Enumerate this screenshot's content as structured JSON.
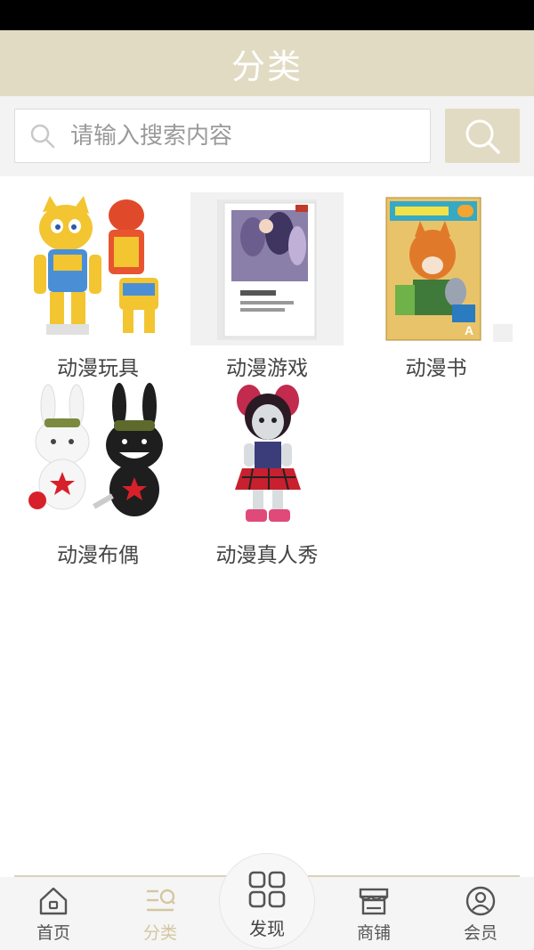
{
  "header": {
    "title": "分类"
  },
  "search": {
    "placeholder": "请输入搜索内容",
    "value": ""
  },
  "categories": [
    {
      "label": "动漫玩具",
      "icon": "toy-robot-image"
    },
    {
      "label": "动漫游戏",
      "icon": "game-box-image"
    },
    {
      "label": "动漫书",
      "icon": "comic-book-image"
    },
    {
      "label": "动漫布偶",
      "icon": "plush-rabbit-image"
    },
    {
      "label": "动漫真人秀",
      "icon": "doll-image"
    }
  ],
  "tabbar": {
    "home": "首页",
    "category": "分类",
    "discover": "发现",
    "shop": "商铺",
    "member": "会员"
  },
  "colors": {
    "accent": "#e2dbc3",
    "active_tab": "#d3c7a0"
  }
}
